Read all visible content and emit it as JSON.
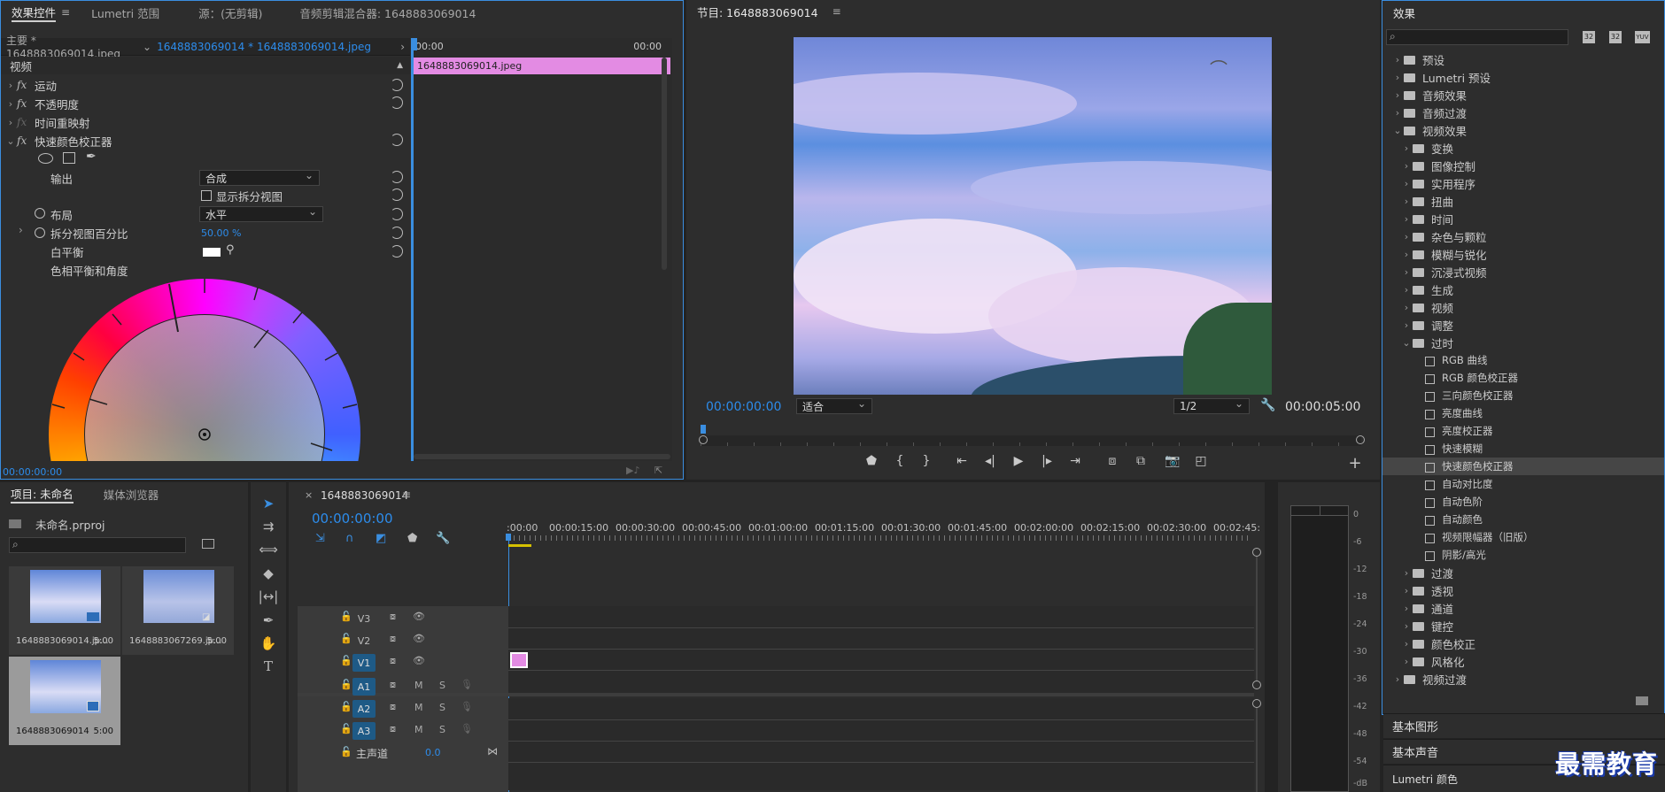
{
  "effect_controls": {
    "tabs": [
      "效果控件",
      "Lumetri 范围",
      "源：(无剪辑)",
      "音频剪辑混合器: 1648883069014"
    ],
    "master_label": "主要 * 1648883069014.jpeg",
    "clip_dropdown": "1648883069014 * 1648883069014.jpeg",
    "mini_time_start": "00:00",
    "mini_time_end": "00:00",
    "clip_bar_label": "1648883069014.jpeg",
    "section": "视频",
    "effects": [
      "运动",
      "不透明度",
      "时间重映射",
      "快速颜色校正器"
    ],
    "output_label": "输出",
    "output_value": "合成",
    "split_view_label": "显示拆分视图",
    "layout_label": "布局",
    "layout_value": "水平",
    "split_percent_label": "拆分视图百分比",
    "split_percent_value": "50.00 %",
    "white_balance_label": "白平衡",
    "hue_balance_label": "色相平衡和角度",
    "timecode": "00:00:00:00"
  },
  "program": {
    "title": "节目: 1648883069014",
    "timecode": "00:00:00:00",
    "fit": "适合",
    "resolution": "1/2",
    "duration": "00:00:05:00"
  },
  "effects_panel": {
    "title": "效果",
    "search_placeholder": "",
    "badges": [
      "32",
      "32",
      "YUV"
    ],
    "top_items": [
      "预设",
      "Lumetri 预设",
      "音频效果",
      "音频过渡",
      "视频效果"
    ],
    "video_effects": [
      "变换",
      "图像控制",
      "实用程序",
      "扭曲",
      "时间",
      "杂色与颗粒",
      "模糊与锐化",
      "沉浸式视频",
      "生成",
      "视频",
      "调整",
      "过时"
    ],
    "obsolete_items": [
      "RGB 曲线",
      "RGB 颜色校正器",
      "三向颜色校正器",
      "亮度曲线",
      "亮度校正器",
      "快速模糊",
      "快速颜色校正器",
      "自动对比度",
      "自动色阶",
      "自动颜色",
      "视频限幅器（旧版）",
      "阴影/高光"
    ],
    "after_items": [
      "过渡",
      "透视",
      "通道",
      "键控",
      "颜色校正",
      "风格化"
    ],
    "last_item": "视频过渡",
    "bottom_tabs": [
      "基本图形",
      "基本声音",
      "Lumetri 颜色"
    ]
  },
  "project": {
    "tabs": [
      "项目: 未命名",
      "媒体浏览器"
    ],
    "file": "未命名.prproj",
    "items": [
      {
        "name": "1648883069014.jp...",
        "dur": "5:00"
      },
      {
        "name": "1648883067269.jp...",
        "dur": "5:00"
      },
      {
        "name": "1648883069014",
        "dur": "5:00"
      }
    ]
  },
  "timeline": {
    "tab": "1648883069014",
    "timecode": "00:00:00:00",
    "ruler": [
      ":00:00",
      "00:00:15:00",
      "00:00:30:00",
      "00:00:45:00",
      "00:01:00:00",
      "00:01:15:00",
      "00:01:30:00",
      "00:01:45:00",
      "00:02:00:00",
      "00:02:15:00",
      "00:02:30:00",
      "00:02:45:"
    ],
    "video_tracks": [
      "V3",
      "V2",
      "V1"
    ],
    "audio_tracks": [
      "A1",
      "A2",
      "A3"
    ],
    "master_label": "主声道",
    "master_value": "0.0",
    "m_label": "M",
    "s_label": "S"
  },
  "meter": {
    "labels": [
      "0",
      "-6",
      "-12",
      "-18",
      "-24",
      "-30",
      "-36",
      "-42",
      "-48",
      "-54",
      "-dB"
    ]
  },
  "watermark": "最需教育",
  "colors": {
    "accent": "#2d8ceb",
    "clip": "#e38be3",
    "track_sel": "#1e5a86"
  }
}
